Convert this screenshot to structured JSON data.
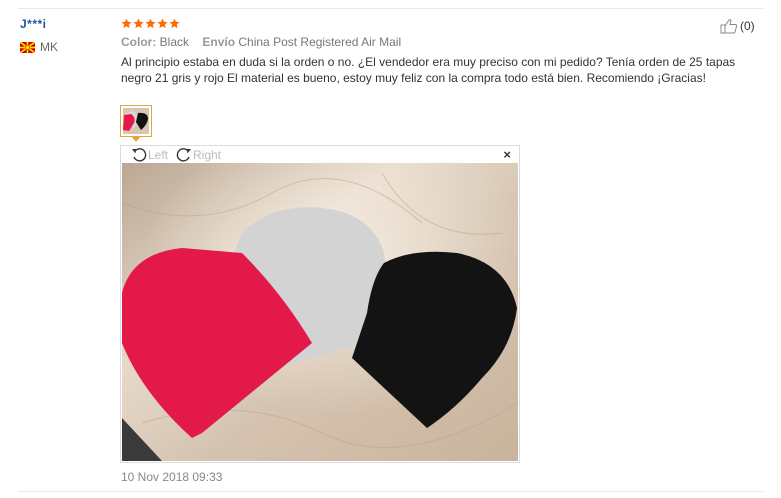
{
  "review": {
    "user_name": "J***i",
    "country_code": "MK",
    "rating_stars": 5,
    "color_label": "Color:",
    "color_value": "Black",
    "shipping_label": "Envío",
    "shipping_value": "China Post Registered Air Mail",
    "text": "Al principio estaba en duda si la orden o no. ¿El vendedor era muy preciso con mi pedido? Tenía orden de 25 tapas negro 21 gris y rojo El material es bueno, estoy muy feliz con la compra todo está bien. Recomiendo ¡Gracias!",
    "helpful_count": "(0)",
    "date": "10 Nov 2018 09:33"
  },
  "viewer": {
    "rotate_left_label": "Left",
    "rotate_right_label": "Right",
    "close_glyph": "×"
  },
  "icons": {
    "star": "star-icon",
    "thumbs_up": "thumbs-up-icon",
    "flag": "macedonia-flag-icon",
    "rotate_left": "rotate-left-icon",
    "rotate_right": "rotate-right-icon",
    "close": "close-icon"
  },
  "colors": {
    "star": "#ff6a00",
    "username": "#1a56a6",
    "thumbnail_border": "#e4a53a",
    "hat_red": "#e3194a",
    "hat_grey": "#d3d3d3",
    "hat_black": "#111111"
  }
}
